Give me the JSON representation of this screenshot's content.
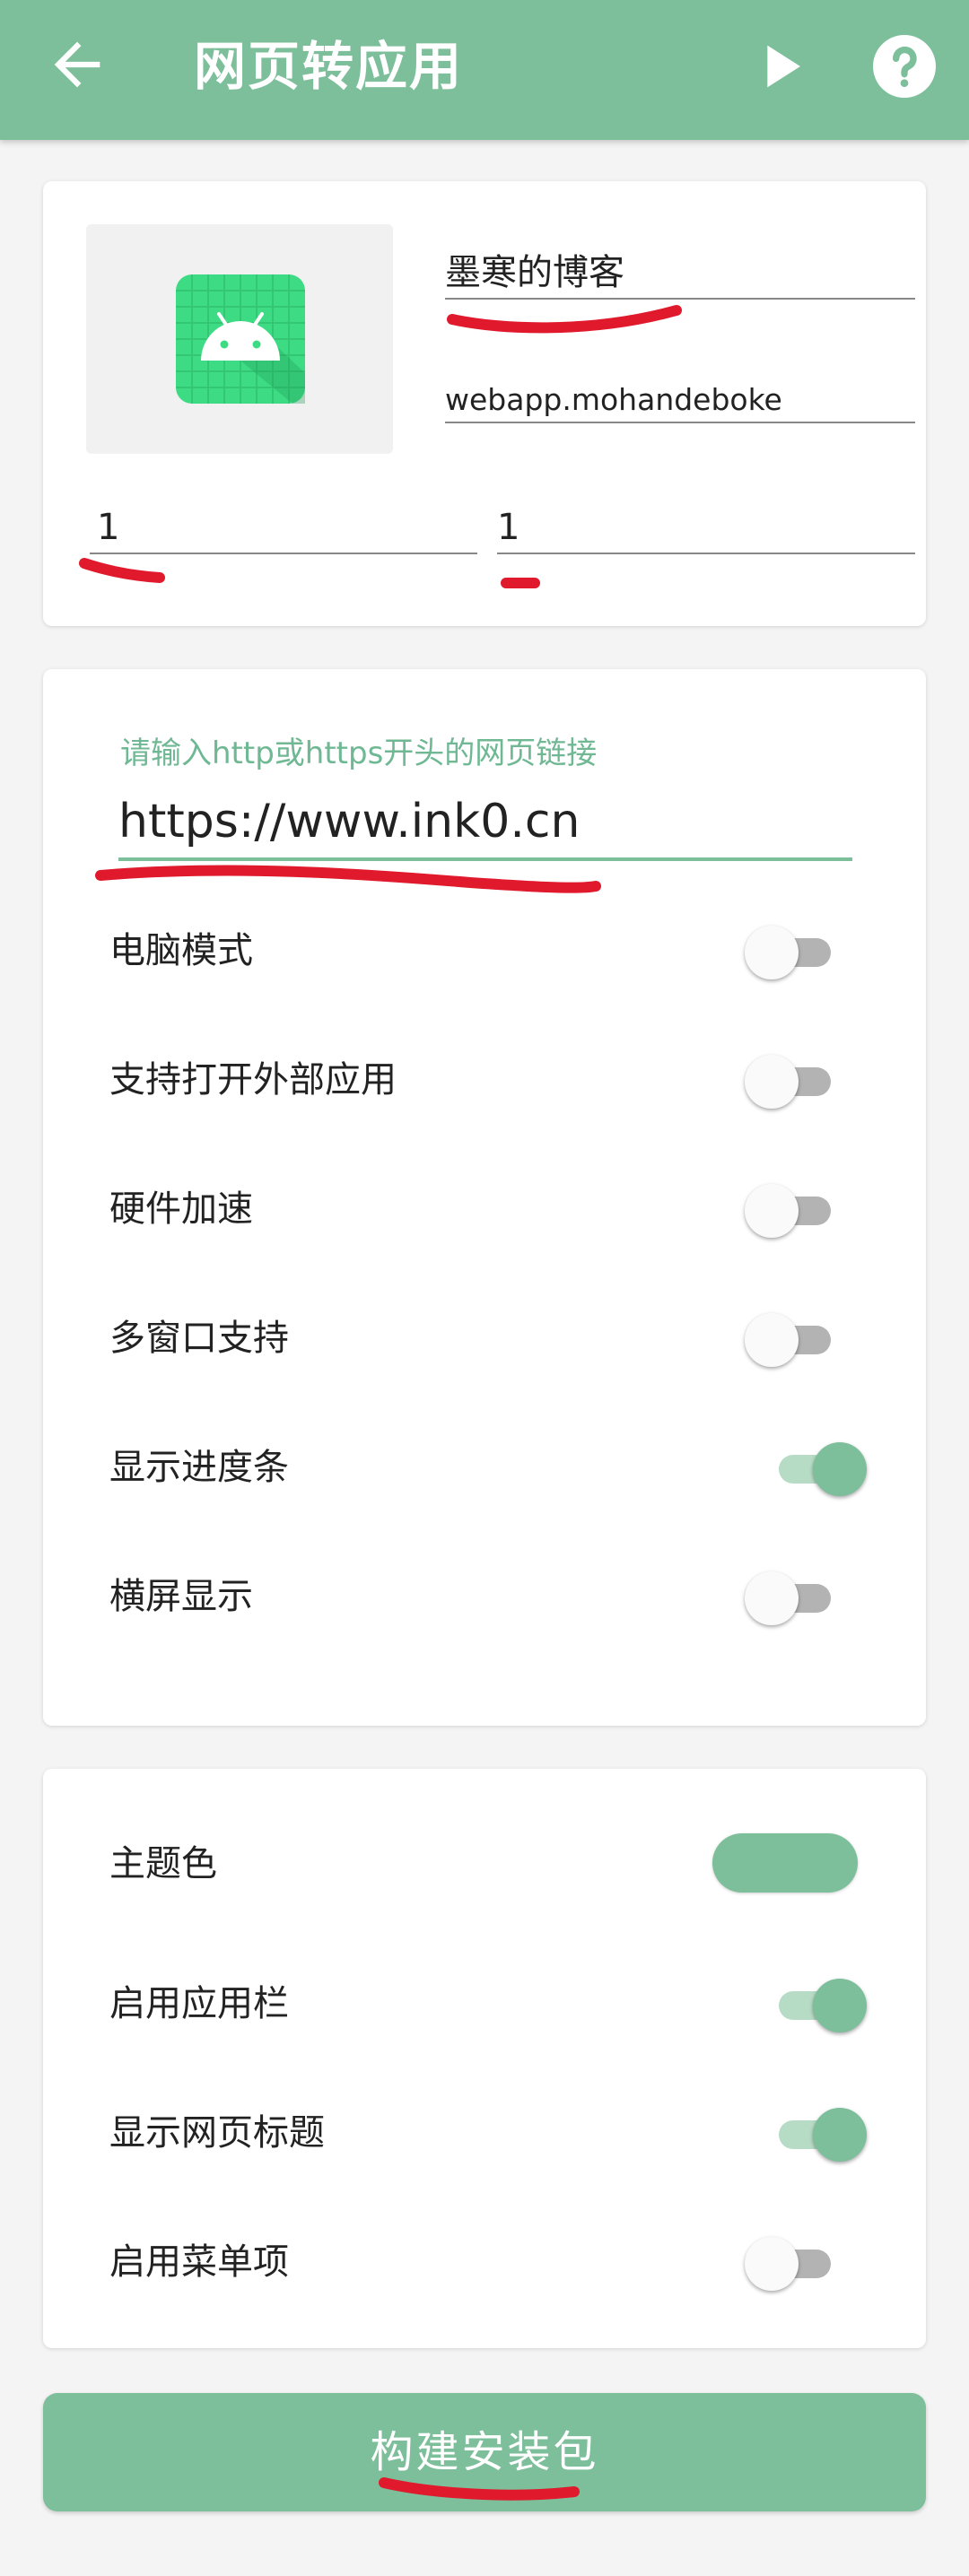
{
  "appbar": {
    "title": "网页转应用",
    "icons": [
      "arrow-left-icon",
      "play-icon",
      "help-icon"
    ]
  },
  "app_info": {
    "name": "墨寒的博客",
    "package": "webapp.mohandeboke",
    "version_name": "1",
    "version_code": "1",
    "icon": "android-app-icon"
  },
  "url_section": {
    "hint": "请输入http或https开头的网页链接",
    "url": "https://www.ink0.cn"
  },
  "options": [
    {
      "label": "电脑模式",
      "enabled": false
    },
    {
      "label": "支持打开外部应用",
      "enabled": false
    },
    {
      "label": "硬件加速",
      "enabled": false
    },
    {
      "label": "多窗口支持",
      "enabled": false
    },
    {
      "label": "显示进度条",
      "enabled": true
    },
    {
      "label": "横屏显示",
      "enabled": false
    }
  ],
  "appearance": {
    "theme_color_label": "主题色",
    "theme_color": "#7cbf9a",
    "items": [
      {
        "label": "启用应用栏",
        "enabled": true
      },
      {
        "label": "显示网页标题",
        "enabled": true
      },
      {
        "label": "启用菜单项",
        "enabled": false
      }
    ]
  },
  "build_button": "构建安装包",
  "colors": {
    "accent": "#7cbf9a",
    "annotation": "#e0192d"
  }
}
